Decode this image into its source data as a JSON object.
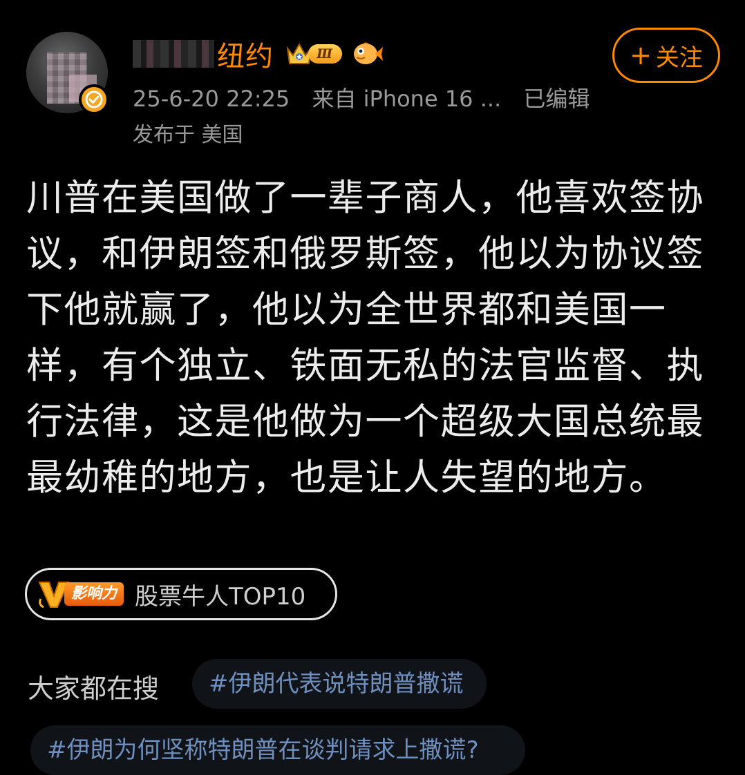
{
  "header": {
    "username": "纽约",
    "level": "Ⅲ",
    "follow_label": "关注",
    "follow_plus": "+",
    "timestamp": "25-6-20 22:25",
    "source": "来自 iPhone 16 ...",
    "edited": "已编辑",
    "location": "发布于 美国"
  },
  "post": {
    "text": "川普在美国做了一辈子商人，他喜欢签协议，和伊朗签和俄罗斯签，他以为协议签下他就赢了，他以为全世界都和美国一样，有个独立、铁面无私的法官监督、执行法律，这是他做为一个超级大国总统最最幼稚的地方，也是让人失望的地方。"
  },
  "badge": {
    "tag": "影响力",
    "label": "股票牛人TOP10"
  },
  "trending": {
    "label": "大家都在搜",
    "topics": [
      "#伊朗代表说特朗普撒谎",
      "#伊朗为何坚称特朗普在谈判请求上撒谎?"
    ]
  },
  "colors": {
    "accent": "#ff8a00",
    "topic": "#6f8fbf",
    "background": "#000000"
  }
}
